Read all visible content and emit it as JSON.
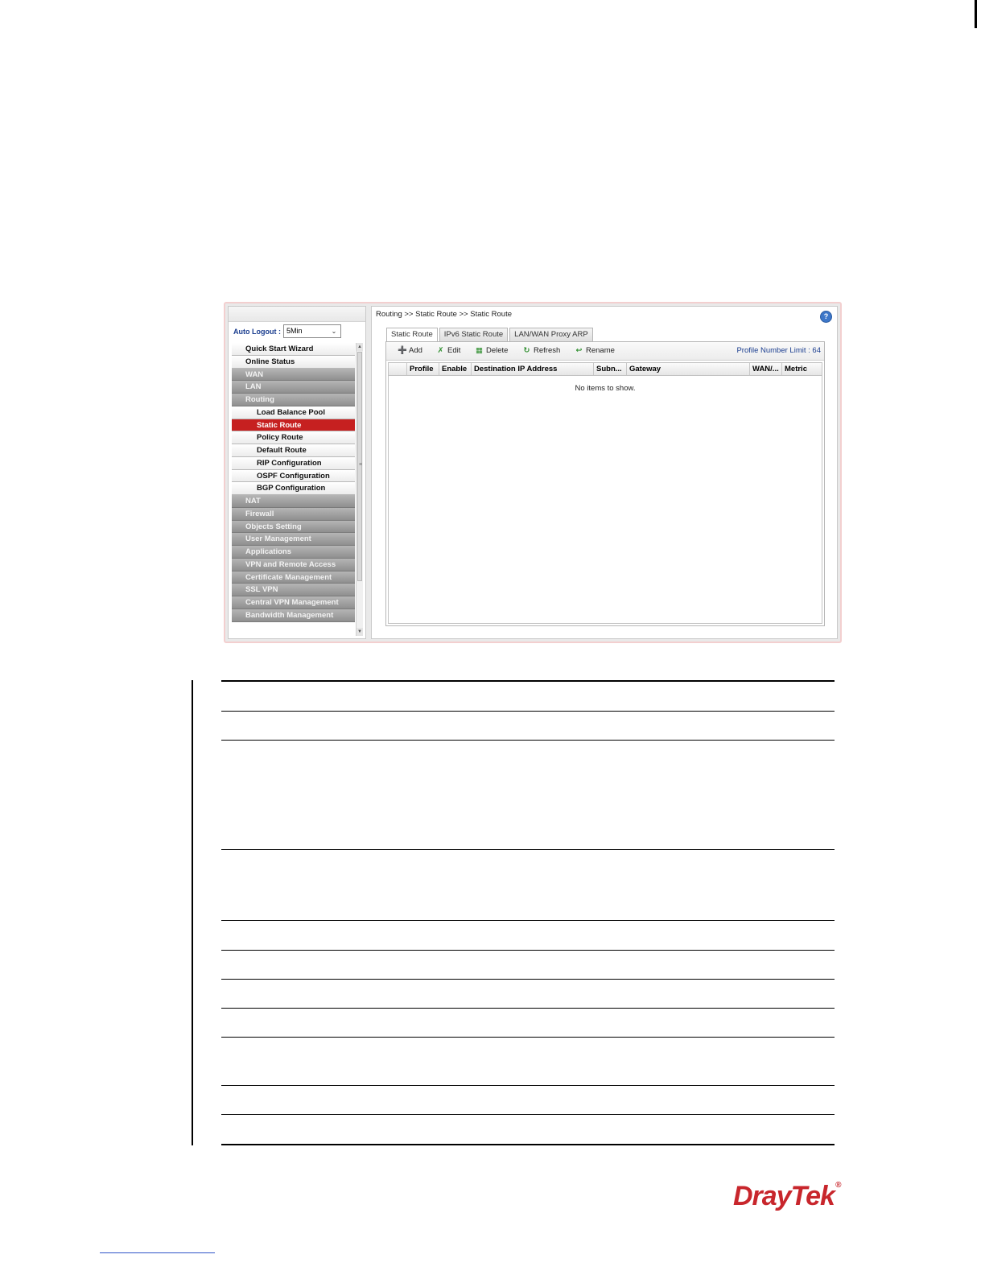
{
  "sidebar": {
    "auto_logout_label": "Auto Logout :",
    "auto_logout_value": "5Min",
    "items": [
      {
        "label": "Quick Start Wizard",
        "type": "top"
      },
      {
        "label": "Online Status",
        "type": "top"
      },
      {
        "label": "WAN",
        "type": "group"
      },
      {
        "label": "LAN",
        "type": "group"
      },
      {
        "label": "Routing",
        "type": "group"
      },
      {
        "label": "Load Balance Pool",
        "type": "sub"
      },
      {
        "label": "Static Route",
        "type": "sub-active"
      },
      {
        "label": "Policy Route",
        "type": "sub"
      },
      {
        "label": "Default Route",
        "type": "sub"
      },
      {
        "label": "RIP Configuration",
        "type": "sub"
      },
      {
        "label": "OSPF Configuration",
        "type": "sub"
      },
      {
        "label": "BGP Configuration",
        "type": "sub"
      },
      {
        "label": "NAT",
        "type": "group"
      },
      {
        "label": "Firewall",
        "type": "group"
      },
      {
        "label": "Objects Setting",
        "type": "group"
      },
      {
        "label": "User Management",
        "type": "group"
      },
      {
        "label": "Applications",
        "type": "group"
      },
      {
        "label": "VPN and Remote Access",
        "type": "group"
      },
      {
        "label": "Certificate Management",
        "type": "group"
      },
      {
        "label": "SSL VPN",
        "type": "group"
      },
      {
        "label": "Central VPN Management",
        "type": "group"
      },
      {
        "label": "Bandwidth Management",
        "type": "group"
      }
    ]
  },
  "main": {
    "breadcrumb": "Routing >> Static Route >> Static Route",
    "tabs": [
      "Static Route",
      "IPv6 Static Route",
      "LAN/WAN Proxy ARP"
    ],
    "toolbar": {
      "add": "Add",
      "edit": "Edit",
      "delete": "Delete",
      "refresh": "Refresh",
      "rename": "Rename",
      "limit_label": "Profile Number Limit :",
      "limit_value": "64"
    },
    "columns": [
      "Profile",
      "Enable",
      "Destination IP Address",
      "Subn...",
      "Gateway",
      "WAN/...",
      "Metric"
    ],
    "empty_message": "No items to show."
  },
  "brand": {
    "logo_text": "DrayTek",
    "color": "#c8262c",
    "active_color": "#c62020"
  }
}
